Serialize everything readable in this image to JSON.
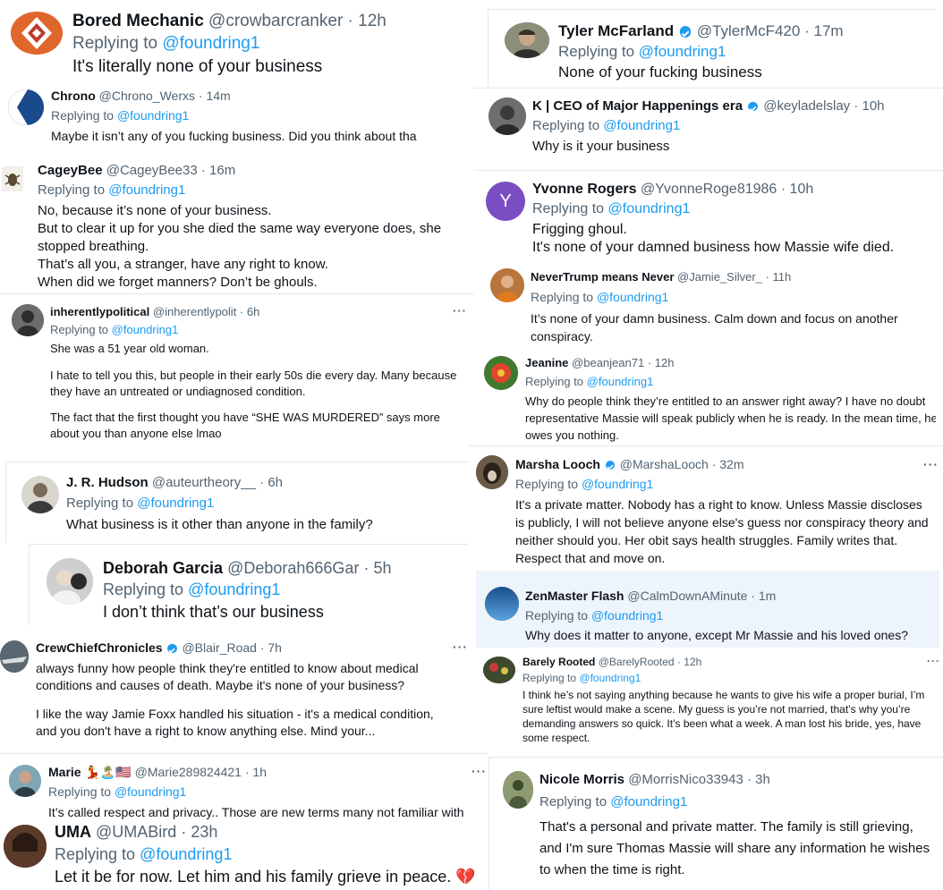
{
  "tweets": [
    {
      "name": "Bored Mechanic",
      "handle": "@crowbarcranker",
      "time": "12h",
      "replying_prefix": "Replying to",
      "replying_to": "@foundring1",
      "lines": [
        "It's literally none of your business"
      ]
    },
    {
      "name": "Chrono",
      "handle": "@Chrono_Werxs",
      "time": "14m",
      "replying_prefix": "Replying to",
      "replying_to": "@foundring1",
      "lines": [
        "Maybe it isn’t any of you fucking business.  Did you think about tha"
      ]
    },
    {
      "name": "CageyBee",
      "handle": "@CageyBee33",
      "time": "16m",
      "replying_prefix": "Replying to",
      "replying_to": "@foundring1",
      "lines": [
        "No, because it’s none of your business.",
        "But to clear it up for you she died the same way everyone does, she",
        "stopped breathing.",
        "That’s all you, a stranger, have any right to know.",
        "When did we forget manners? Don’t be ghouls."
      ]
    },
    {
      "name": "inherentlypolitical",
      "handle": "@inherentlypolit",
      "time": "6h",
      "replying_prefix": "Replying to",
      "replying_to": "@foundring1",
      "lines": [
        "She was a 51 year old woman.",
        "I hate to tell you this, but people in their early 50s die every day.  Many because they have an untreated or undiagnosed condition.",
        "The fact that the first thought you have “SHE WAS MURDERED” says more about you than anyone else lmao"
      ],
      "more": "···"
    },
    {
      "name": "J. R. Hudson",
      "handle": "@auteurtheory__",
      "time": "6h",
      "replying_prefix": "Replying to",
      "replying_to": "@foundring1",
      "lines": [
        "What business is it other than anyone in the family?"
      ]
    },
    {
      "name": "Deborah Garcia",
      "handle": "@Deborah666Gar",
      "time": "5h",
      "replying_prefix": "Replying to",
      "replying_to": "@foundring1",
      "lines": [
        "I don’t think that’s our business"
      ]
    },
    {
      "name": "CrewChiefChronicles",
      "handle": "@Blair_Road",
      "time": "7h",
      "replying_prefix": "Replying to",
      "replying_to": "@foundring1",
      "lines": [
        "always funny how people think they're entitled to know about medical conditions and causes of death. Maybe it's none of your business?",
        "I like the way Jamie Foxx handled his situation - it's a medical condition, and you don't have a right to know anything else. Mind your..."
      ],
      "more": "···",
      "verified": true
    },
    {
      "name": "Marie 💃🏝️🇺🇸",
      "handle": "@Marie289824421",
      "time": "1h",
      "replying_prefix": "Replying to",
      "replying_to": "@foundring1",
      "lines": [
        "It’s called respect and privacy.. Those are new terms many not familiar with"
      ],
      "more": "···"
    },
    {
      "name": "UMA",
      "handle": "@UMABird",
      "time": "23h",
      "replying_prefix": "Replying to",
      "replying_to": "@foundring1",
      "lines": [
        "Let it be for now. Let him and his family grieve in peace. 💔"
      ]
    },
    {
      "name": "Tyler McFarland",
      "handle": "@TylerMcF420",
      "time": "17m",
      "replying_prefix": "Replying to",
      "replying_to": "@foundring1",
      "lines": [
        "None of your fucking business"
      ],
      "verified": true
    },
    {
      "name": "K | CEO of Major Happenings era",
      "handle": "@keyladelslay",
      "time": "10h",
      "replying_prefix": "Replying to",
      "replying_to": "@foundring1",
      "lines": [
        "Why is it your business"
      ],
      "verified": true
    },
    {
      "name": "Yvonne Rogers",
      "handle": "@YvonneRoge81986",
      "time": "10h",
      "replying_prefix": "Replying to",
      "replying_to": "@foundring1",
      "lines": [
        "Frigging ghoul.",
        "It's none of your damned business how Massie wife died."
      ],
      "avatar_letter": "Y"
    },
    {
      "name": "NeverTrump means Never",
      "handle": "@Jamie_Silver_",
      "time": "11h",
      "replying_prefix": "Replying to",
      "replying_to": "@foundring1",
      "lines": [
        "It’s none of your damn business.  Calm down and focus on another conspiracy."
      ]
    },
    {
      "name": "Jeanine",
      "handle": "@beanjean71",
      "time": "12h",
      "replying_prefix": "Replying to",
      "replying_to": "@foundring1",
      "lines": [
        "Why do people think they’re entitled to an answer right away? I have no doubt representative Massie will speak publicly when he is ready. In the mean time, he owes you nothing."
      ]
    },
    {
      "name": "Marsha Looch",
      "handle": "@MarshaLooch",
      "time": "32m",
      "replying_prefix": "Replying to",
      "replying_to": "@foundring1",
      "lines": [
        "It's a private matter.  Nobody has a right to know.  Unless Massie discloses is publicly, I will not believe anyone else's guess nor conspiracy theory and neither should you. Her obit says health struggles. Family writes that. Respect that and move on."
      ],
      "more": "···",
      "verified": true
    },
    {
      "name": "ZenMaster Flash",
      "handle": "@CalmDownAMinute",
      "time": "1m",
      "replying_prefix": "Replying to",
      "replying_to": "@foundring1",
      "lines": [
        "Why does it matter to anyone, except Mr Massie and his loved ones?"
      ]
    },
    {
      "name": "Barely Rooted",
      "handle": "@BarelyRooted",
      "time": "12h",
      "replying_prefix": "Replying to",
      "replying_to": "@foundring1",
      "lines": [
        "I think he’s not saying anything because he wants to give his wife a proper burial, I’m sure leftist would make a scene. My guess is you’re not married, that’s why you’re demanding answers so quick. It’s been what a week. A man lost his bride, yes, have some respect."
      ],
      "more": "···"
    },
    {
      "name": "Nicole Morris",
      "handle": "@MorrisNico33943",
      "time": "3h",
      "replying_prefix": "Replying to",
      "replying_to": "@foundring1",
      "lines": [
        "That's a personal and private matter. The family is still grieving, and I'm sure Thomas Massie will share any information he wishes to when the time is right."
      ]
    }
  ],
  "colors": {
    "link": "#1d9bf0",
    "muted": "#536471",
    "text": "#0f1419",
    "highlight": "#eef4fb",
    "verified": "#1d9bf0"
  }
}
